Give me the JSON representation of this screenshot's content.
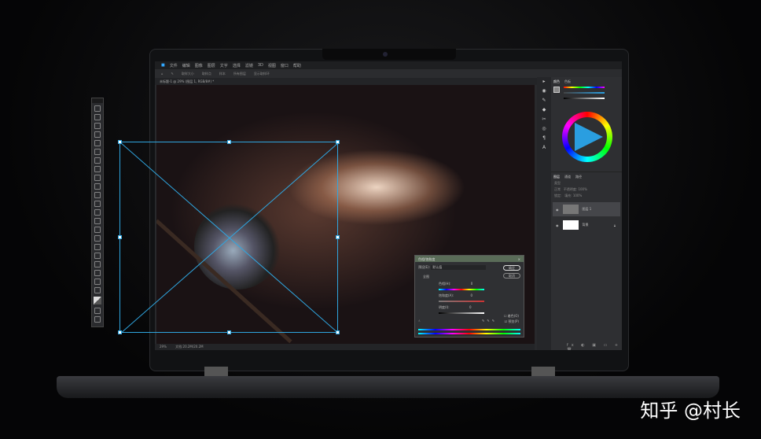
{
  "menu": [
    "文件",
    "编辑",
    "图像",
    "图层",
    "文字",
    "选择",
    "滤镜",
    "3D",
    "视图",
    "窗口",
    "帮助"
  ],
  "options": {
    "sample_size": "取样大小",
    "sample_value": "取样点",
    "sample": "样本",
    "all_layers": "所有图层",
    "show_ring": "显示取样环"
  },
  "doc_tab": "未标题-1 @ 29% (图层 1, RGB/8#) *",
  "status": {
    "zoom": "29%",
    "doc_size": "文档:20.2M/20.2M"
  },
  "color_panel": {
    "tabs": [
      "颜色",
      "色板"
    ]
  },
  "layers_panel": {
    "tabs": [
      "图层",
      "通道",
      "路径"
    ],
    "kind": "类型",
    "mode": "正常",
    "opacity_label": "不透明度:",
    "opacity": "100%",
    "lock": "锁定:",
    "fill_label": "填充:",
    "fill": "100%",
    "layers": [
      {
        "name": "图层 1"
      },
      {
        "name": "背景"
      }
    ]
  },
  "dialog": {
    "title": "色相/饱和度",
    "preset_label": "预设(E):",
    "preset": "默认值",
    "ok": "确定",
    "cancel": "取消",
    "channel": "全图",
    "hue_label": "色相(H):",
    "hue": "0",
    "sat_label": "饱和度(A):",
    "sat": "0",
    "light_label": "明度(I):",
    "light": "0",
    "colorize": "着色(O)",
    "preview": "预览(P)"
  },
  "watermark": "知乎 @村长"
}
